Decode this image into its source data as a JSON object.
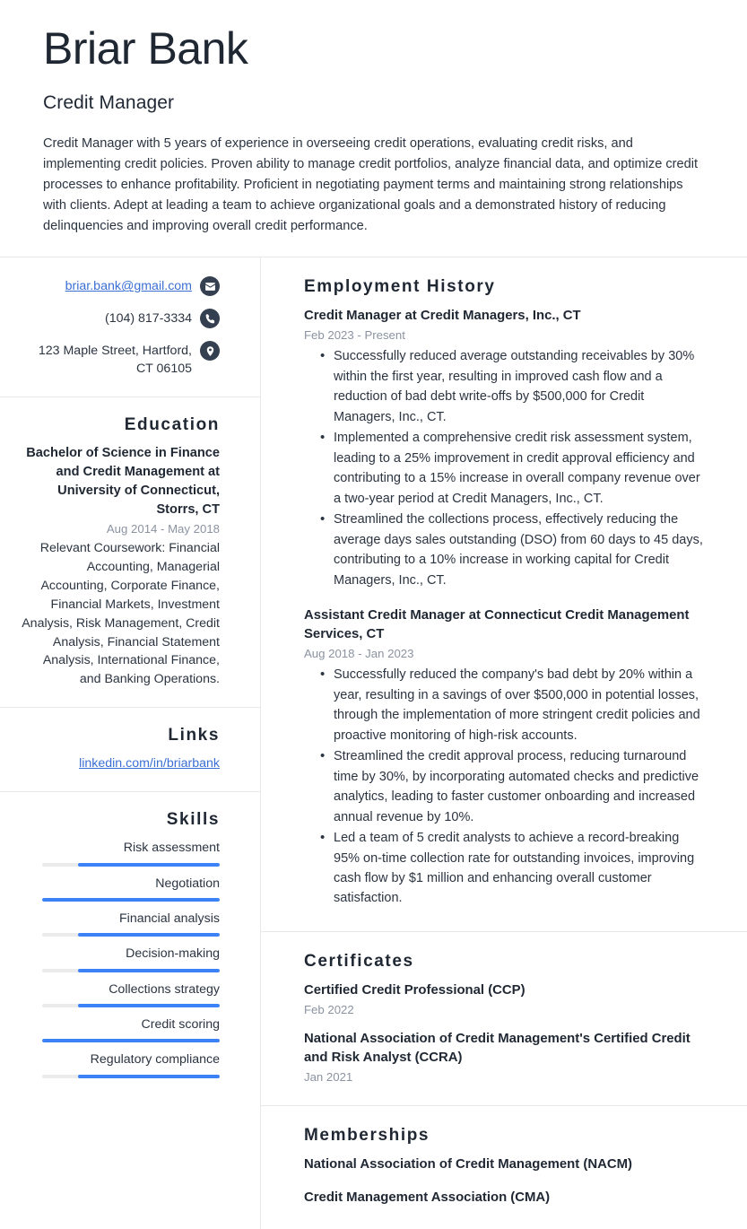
{
  "header": {
    "full_name": "Briar Bank",
    "job_title": "Credit Manager",
    "summary": "Credit Manager with 5 years of experience in overseeing credit operations, evaluating credit risks, and implementing credit policies. Proven ability to manage credit portfolios, analyze financial data, and optimize credit processes to enhance profitability. Proficient in negotiating payment terms and maintaining strong relationships with clients. Adept at leading a team to achieve organizational goals and a demonstrated history of reducing delinquencies and improving overall credit performance."
  },
  "contact": {
    "email": "briar.bank@gmail.com",
    "phone": "(104) 817-3334",
    "address": "123 Maple Street, Hartford, CT 06105",
    "icons": {
      "email": "envelope-icon",
      "phone": "phone-icon",
      "address": "location-pin-icon"
    }
  },
  "education": {
    "heading": "Education",
    "degree": "Bachelor of Science in Finance and Credit Management at University of Connecticut, Storrs, CT",
    "date": "Aug 2014 - May 2018",
    "description": "Relevant Coursework: Financial Accounting, Managerial Accounting, Corporate Finance, Financial Markets, Investment Analysis, Risk Management, Credit Analysis, Financial Statement Analysis, International Finance, and Banking Operations."
  },
  "links": {
    "heading": "Links",
    "items": [
      {
        "label": "linkedin.com/in/briarbank"
      }
    ]
  },
  "skills": {
    "heading": "Skills",
    "accent_color": "#3b82f6",
    "track_color": "#ebebeb",
    "items": [
      {
        "label": "Risk assessment",
        "level": 80
      },
      {
        "label": "Negotiation",
        "level": 100
      },
      {
        "label": "Financial analysis",
        "level": 80
      },
      {
        "label": "Decision-making",
        "level": 80
      },
      {
        "label": "Collections strategy",
        "level": 80
      },
      {
        "label": "Credit scoring",
        "level": 100
      },
      {
        "label": "Regulatory compliance",
        "level": 80
      }
    ]
  },
  "employment": {
    "heading": "Employment History",
    "entries": [
      {
        "title": "Credit Manager at Credit Managers, Inc., CT",
        "date": "Feb 2023 - Present",
        "bullets": [
          "Successfully reduced average outstanding receivables by 30% within the first year, resulting in improved cash flow and a reduction of bad debt write-offs by $500,000 for Credit Managers, Inc., CT.",
          "Implemented a comprehensive credit risk assessment system, leading to a 25% improvement in credit approval efficiency and contributing to a 15% increase in overall company revenue over a two-year period at Credit Managers, Inc., CT.",
          "Streamlined the collections process, effectively reducing the average days sales outstanding (DSO) from 60 days to 45 days, contributing to a 10% increase in working capital for Credit Managers, Inc., CT."
        ]
      },
      {
        "title": "Assistant Credit Manager at Connecticut Credit Management Services, CT",
        "date": "Aug 2018 - Jan 2023",
        "bullets": [
          "Successfully reduced the company's bad debt by 20% within a year, resulting in a savings of over $500,000 in potential losses, through the implementation of more stringent credit policies and proactive monitoring of high-risk accounts.",
          "Streamlined the credit approval process, reducing turnaround time by 30%, by incorporating automated checks and predictive analytics, leading to faster customer onboarding and increased annual revenue by 10%.",
          "Led a team of 5 credit analysts to achieve a record-breaking 95% on-time collection rate for outstanding invoices, improving cash flow by $1 million and enhancing overall customer satisfaction."
        ]
      }
    ]
  },
  "certificates": {
    "heading": "Certificates",
    "entries": [
      {
        "title": "Certified Credit Professional (CCP)",
        "date": "Feb 2022"
      },
      {
        "title": "National Association of Credit Management's Certified Credit and Risk Analyst (CCRA)",
        "date": "Jan 2021"
      }
    ]
  },
  "memberships": {
    "heading": "Memberships",
    "entries": [
      {
        "title": "National Association of Credit Management (NACM)"
      },
      {
        "title": "Credit Management Association (CMA)"
      }
    ]
  }
}
